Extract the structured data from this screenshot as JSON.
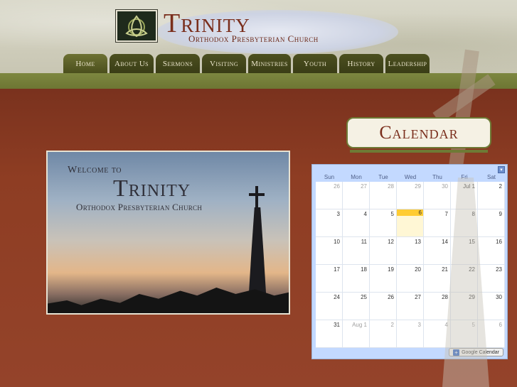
{
  "brand": {
    "title": "Trinity",
    "subtitle": "Orthodox Presbyterian Church"
  },
  "nav": {
    "items": [
      {
        "label": "Home",
        "active": true,
        "width": 62
      },
      {
        "label": "About Us",
        "active": false,
        "width": 62
      },
      {
        "label": "Sermons",
        "active": false,
        "width": 62
      },
      {
        "label": "Visiting",
        "active": false,
        "width": 62
      },
      {
        "label": "Ministries",
        "active": false,
        "width": 60
      },
      {
        "label": "Youth",
        "active": false,
        "width": 62
      },
      {
        "label": "History",
        "active": false,
        "width": 62
      },
      {
        "label": "Leadership",
        "active": false,
        "width": 62
      }
    ]
  },
  "calendar_section": {
    "heading": "Calendar"
  },
  "welcome": {
    "line1": "Welcome to",
    "line2": "Trinity",
    "line3": "Orthodox Presbyterian Church"
  },
  "calendar": {
    "menu_icon": "chevron-down-icon",
    "weekdays": [
      "Sun",
      "Mon",
      "Tue",
      "Wed",
      "Thu",
      "Fri",
      "Sat"
    ],
    "weeks": [
      [
        {
          "d": "26",
          "o": true
        },
        {
          "d": "27",
          "o": true
        },
        {
          "d": "28",
          "o": true
        },
        {
          "d": "29",
          "o": true
        },
        {
          "d": "30",
          "o": true
        },
        {
          "d": "Jul 1",
          "o": false
        },
        {
          "d": "2",
          "o": false
        }
      ],
      [
        {
          "d": "3",
          "o": false
        },
        {
          "d": "4",
          "o": false
        },
        {
          "d": "5",
          "o": false
        },
        {
          "d": "6",
          "o": false,
          "today": true
        },
        {
          "d": "7",
          "o": false
        },
        {
          "d": "8",
          "o": false
        },
        {
          "d": "9",
          "o": false
        }
      ],
      [
        {
          "d": "10",
          "o": false
        },
        {
          "d": "11",
          "o": false
        },
        {
          "d": "12",
          "o": false
        },
        {
          "d": "13",
          "o": false
        },
        {
          "d": "14",
          "o": false
        },
        {
          "d": "15",
          "o": false
        },
        {
          "d": "16",
          "o": false
        }
      ],
      [
        {
          "d": "17",
          "o": false
        },
        {
          "d": "18",
          "o": false
        },
        {
          "d": "19",
          "o": false
        },
        {
          "d": "20",
          "o": false
        },
        {
          "d": "21",
          "o": false
        },
        {
          "d": "22",
          "o": false
        },
        {
          "d": "23",
          "o": false
        }
      ],
      [
        {
          "d": "24",
          "o": false
        },
        {
          "d": "25",
          "o": false
        },
        {
          "d": "26",
          "o": false
        },
        {
          "d": "27",
          "o": false
        },
        {
          "d": "28",
          "o": false
        },
        {
          "d": "29",
          "o": false
        },
        {
          "d": "30",
          "o": false
        }
      ],
      [
        {
          "d": "31",
          "o": false
        },
        {
          "d": "Aug 1",
          "o": true
        },
        {
          "d": "2",
          "o": true
        },
        {
          "d": "3",
          "o": true
        },
        {
          "d": "4",
          "o": true
        },
        {
          "d": "5",
          "o": true
        },
        {
          "d": "6",
          "o": true
        }
      ]
    ],
    "footer_label": "Google Calendar",
    "accent_color": "#c3d9ff",
    "today_color": "#ffcc33"
  }
}
